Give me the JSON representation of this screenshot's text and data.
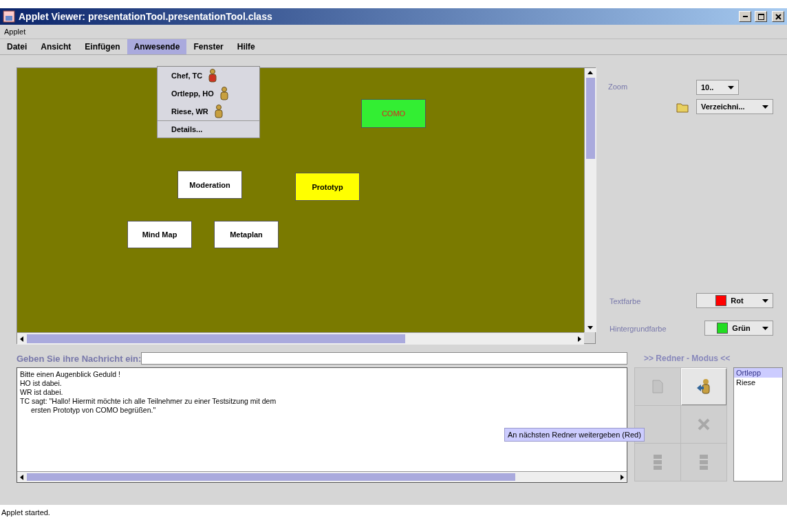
{
  "window": {
    "title": "Applet Viewer: presentationTool.presentationTool.class"
  },
  "applet_menu": "Applet",
  "menubar": [
    {
      "label": "Datei",
      "selected": false
    },
    {
      "label": "Ansicht",
      "selected": false
    },
    {
      "label": "Einfügen",
      "selected": false
    },
    {
      "label": "Anwesende",
      "selected": true
    },
    {
      "label": "Fenster",
      "selected": false
    },
    {
      "label": "Hilfe",
      "selected": false
    }
  ],
  "attendees_menu": {
    "items": [
      {
        "label": "Chef, TC",
        "speaking": true
      },
      {
        "label": "Ortlepp, HO",
        "speaking": false
      },
      {
        "label": "Riese, WR",
        "speaking": false
      }
    ],
    "details": "Details..."
  },
  "canvas": {
    "cards": [
      {
        "label": "COMO",
        "color": "#33ee33",
        "kind": "central"
      },
      {
        "label": "Moderation",
        "color": "#ffffff",
        "kind": "note"
      },
      {
        "label": "Prototyp",
        "color": "#ffff00",
        "kind": "note"
      },
      {
        "label": "Mind Map",
        "color": "#ffffff",
        "kind": "note"
      },
      {
        "label": "Metaplan",
        "color": "#ffffff",
        "kind": "note"
      }
    ]
  },
  "side_panel": {
    "zoom_label": "Zoom",
    "zoom_value": "10..",
    "directory_value": "Verzeichni...",
    "colors": [
      {
        "label": "Textfarbe",
        "value": "Rot",
        "color": "#ff0000"
      },
      {
        "label": "Hintergrundfarbe",
        "value": "Grün",
        "color": "#22dd22"
      }
    ]
  },
  "message_prompt": "Geben Sie ihre Nachricht ein:",
  "chat": [
    {
      "lines": [
        "Bitte einen Augenblick Geduld !"
      ]
    },
    {
      "lines": [
        "HO ist dabei."
      ]
    },
    {
      "lines": [
        "WR ist dabei."
      ]
    },
    {
      "lines": [
        "TC sagt: \"Hallo! Hiermit möchte ich alle Teilnehmer zu einer Testsitzung mit dem",
        "ersten Prototyp von COMO begrüßen.\""
      ]
    }
  ],
  "speaker_mode": {
    "title": ">> Redner - Modus <<",
    "buttons": [
      {
        "kind": "document",
        "disabled": true
      },
      {
        "kind": "pass",
        "disabled": false
      },
      {
        "kind": "blank",
        "disabled": true
      },
      {
        "kind": "remove",
        "disabled": true
      },
      {
        "kind": "stack",
        "disabled": true
      },
      {
        "kind": "stack",
        "disabled": true
      }
    ],
    "queue": [
      {
        "label": "Ortlepp",
        "selected": true
      },
      {
        "label": "Riese",
        "selected": false
      }
    ],
    "tooltip": "An nächsten Redner weitergeben (Red)"
  },
  "status_bar": "Applet started."
}
